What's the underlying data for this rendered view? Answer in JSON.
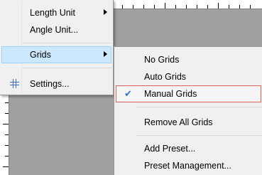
{
  "main_menu": {
    "items": [
      {
        "label": "Length Unit",
        "has_submenu": true
      },
      {
        "label": "Angle Unit..."
      },
      {
        "label": "Grids",
        "has_submenu": true,
        "highlighted": true
      },
      {
        "label": "Settings...",
        "icon": "grid-icon"
      }
    ]
  },
  "grids_submenu": {
    "items": [
      {
        "label": "No Grids"
      },
      {
        "label": "Auto Grids"
      },
      {
        "label": "Manual Grids",
        "checked": true,
        "check_icon": "✔"
      },
      {
        "label": "Remove All Grids"
      },
      {
        "label": "Add Preset..."
      },
      {
        "label": "Preset Management..."
      }
    ]
  },
  "colors": {
    "highlight": "#cce8ff",
    "highlight_border": "#99d1ff",
    "check": "#2a6fc9",
    "selected_border": "#e06060",
    "menu_bg": "#f0f0f0",
    "canvas": "#a0a0a0"
  }
}
